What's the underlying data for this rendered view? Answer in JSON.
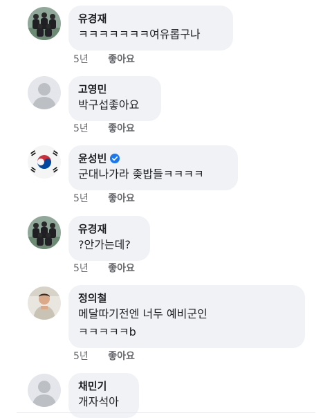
{
  "colors": {
    "bubble_bg": "#f0f2f5",
    "meta_text": "#65676b",
    "verified_blue": "#1877f2"
  },
  "comments": [
    {
      "name": "유경재",
      "text": "ㅋㅋㅋㅋㅋㅋㅋ여유롭구나",
      "time": "5년",
      "like": "좋아요",
      "avatar": "group-photo-avatar"
    },
    {
      "name": "고영민",
      "text": "박구섭좋아요",
      "time": "5년",
      "like": "좋아요",
      "avatar": "default-profile-avatar"
    },
    {
      "name": "윤성빈",
      "text": "군대나가라 좆밥들ㅋㅋㅋㅋ",
      "time": "5년",
      "like": "좋아요",
      "avatar": "korean-flag-avatar",
      "verified": true,
      "verified_icon": "verified-badge-icon"
    },
    {
      "name": "유경재",
      "text": "?안가는데?",
      "time": "5년",
      "like": "좋아요",
      "avatar": "group-photo-avatar"
    },
    {
      "name": "정의철",
      "text": "메달따기전엔 너두 예비군인\nㅋㅋㅋㅋㅋb",
      "time": "5년",
      "like": "좋아요",
      "avatar": "person-photo-avatar"
    },
    {
      "name": "채민기",
      "text": "개자석아",
      "avatar": "default-profile-avatar"
    }
  ]
}
